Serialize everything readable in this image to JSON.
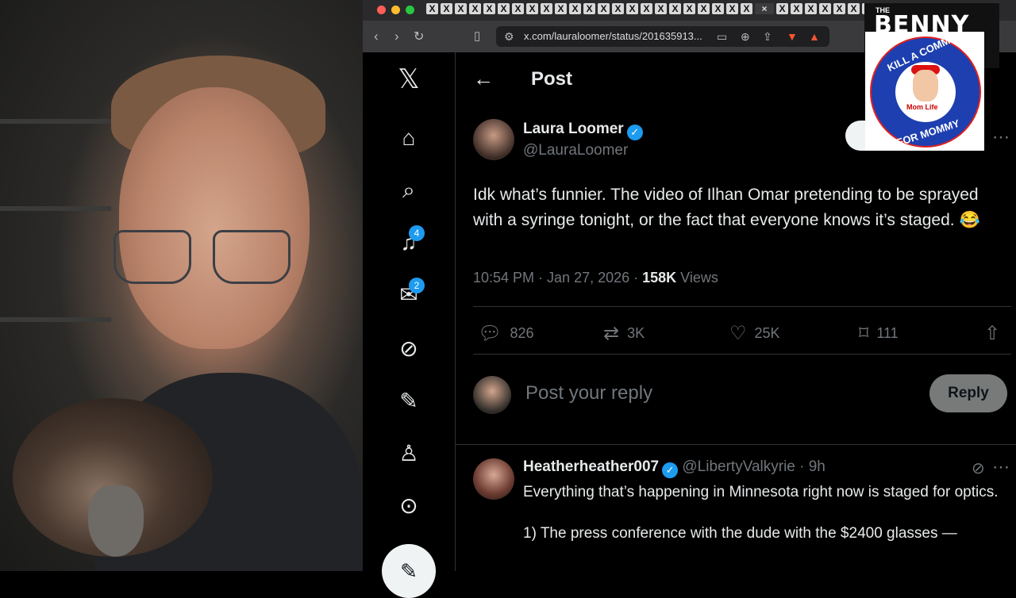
{
  "browser": {
    "address": "x.com/lauraloomer/status/201635913...",
    "tab_glyph": "X",
    "active_tab_close": "×",
    "new_tab": "+"
  },
  "sidebar": {
    "logo": "𝕏",
    "notifications_count": "4",
    "messages_count": "2"
  },
  "header": {
    "title": "Post"
  },
  "post": {
    "author_name": "Laura Loomer",
    "author_handle": "@LauraLoomer",
    "text": "Idk what’s funnier. The video of Ilhan Omar pretending to be sprayed with a syringe tonight, or the fact that everyone knows it’s staged. 😂",
    "timestamp": "10:54 PM · Jan 27, 2026 · ",
    "views_count": "158K",
    "views_label": " Views",
    "replies": "826",
    "reposts": "3K",
    "likes": "25K",
    "bookmarks": "111"
  },
  "compose": {
    "placeholder": "Post your reply",
    "button": "Reply"
  },
  "reply": {
    "name": "Heatherheather007",
    "handle_time": "@LibertyValkyrie · 9h",
    "text1": "Everything that’s happening in Minnesota right now is staged for optics.",
    "text2": "1) The press conference with the dude with the $2400 glasses —"
  },
  "overlay": {
    "brand_small": "THE",
    "brand": "BENNY",
    "sticker_top": "KILL A COMMIE",
    "sticker_bottom": "FOR MOMMY",
    "sticker_center": "Mom Life"
  },
  "colors": {
    "accent": "#1d9bf0",
    "text": "#e7e9ea",
    "muted": "#71767b"
  }
}
